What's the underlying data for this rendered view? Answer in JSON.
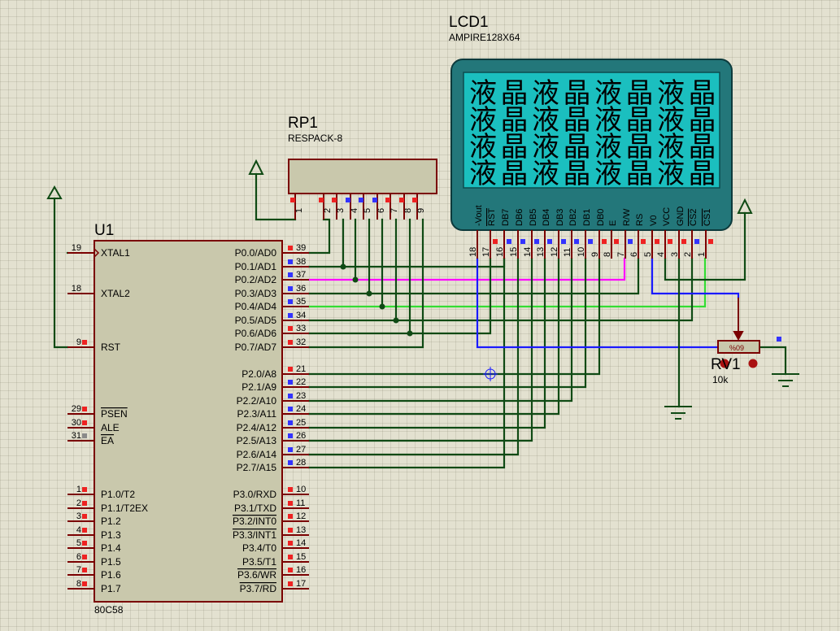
{
  "u1": {
    "ref": "U1",
    "part": "80C58",
    "left_pins": [
      {
        "num": "19",
        "label": "XTAL1"
      },
      {
        "num": "18",
        "label": "XTAL2"
      },
      {
        "num": "9",
        "label": "RST"
      },
      {
        "num": "29",
        "label": "PSEN"
      },
      {
        "num": "30",
        "label": "ALE"
      },
      {
        "num": "31",
        "label": "EA"
      },
      {
        "num": "1",
        "label": "P1.0/T2"
      },
      {
        "num": "2",
        "label": "P1.1/T2EX"
      },
      {
        "num": "3",
        "label": "P1.2"
      },
      {
        "num": "4",
        "label": "P1.3"
      },
      {
        "num": "5",
        "label": "P1.4"
      },
      {
        "num": "6",
        "label": "P1.5"
      },
      {
        "num": "7",
        "label": "P1.6"
      },
      {
        "num": "8",
        "label": "P1.7"
      }
    ],
    "right_pins": [
      {
        "num": "39",
        "label": "P0.0/AD0"
      },
      {
        "num": "38",
        "label": "P0.1/AD1"
      },
      {
        "num": "37",
        "label": "P0.2/AD2"
      },
      {
        "num": "36",
        "label": "P0.3/AD3"
      },
      {
        "num": "35",
        "label": "P0.4/AD4"
      },
      {
        "num": "34",
        "label": "P0.5/AD5"
      },
      {
        "num": "33",
        "label": "P0.6/AD6"
      },
      {
        "num": "32",
        "label": "P0.7/AD7"
      },
      {
        "num": "21",
        "label": "P2.0/A8"
      },
      {
        "num": "22",
        "label": "P2.1/A9"
      },
      {
        "num": "23",
        "label": "P2.2/A10"
      },
      {
        "num": "24",
        "label": "P2.3/A11"
      },
      {
        "num": "25",
        "label": "P2.4/A12"
      },
      {
        "num": "26",
        "label": "P2.5/A13"
      },
      {
        "num": "27",
        "label": "P2.6/A14"
      },
      {
        "num": "28",
        "label": "P2.7/A15"
      },
      {
        "num": "10",
        "label": "P3.0/RXD"
      },
      {
        "num": "11",
        "label": "P3.1/TXD"
      },
      {
        "num": "12",
        "label": "P3.2/INT0"
      },
      {
        "num": "13",
        "label": "P3.3/INT1"
      },
      {
        "num": "14",
        "label": "P3.4/T0"
      },
      {
        "num": "15",
        "label": "P3.5/T1"
      },
      {
        "num": "16",
        "label": "P3.6/WR"
      },
      {
        "num": "17",
        "label": "P3.7/RD"
      }
    ]
  },
  "rp1": {
    "ref": "RP1",
    "part": "RESPACK-8",
    "pins": [
      "1",
      "2",
      "3",
      "4",
      "5",
      "6",
      "7",
      "8",
      "9"
    ]
  },
  "lcd1": {
    "ref": "LCD1",
    "part": "AMPIRE128X64",
    "display_chars": [
      "液",
      "晶"
    ],
    "pins": [
      {
        "num": "18",
        "label": "-Vout"
      },
      {
        "num": "17",
        "label": "RST"
      },
      {
        "num": "16",
        "label": "DB7"
      },
      {
        "num": "15",
        "label": "DB6"
      },
      {
        "num": "14",
        "label": "DB5"
      },
      {
        "num": "13",
        "label": "DB4"
      },
      {
        "num": "12",
        "label": "DB3"
      },
      {
        "num": "11",
        "label": "DB2"
      },
      {
        "num": "10",
        "label": "DB1"
      },
      {
        "num": "9",
        "label": "DB0"
      },
      {
        "num": "8",
        "label": "E"
      },
      {
        "num": "7",
        "label": "R/W"
      },
      {
        "num": "6",
        "label": "RS"
      },
      {
        "num": "5",
        "label": "V0"
      },
      {
        "num": "4",
        "label": "VCC"
      },
      {
        "num": "3",
        "label": "GND"
      },
      {
        "num": "2",
        "label": "CS2"
      },
      {
        "num": "1",
        "label": "CS1"
      }
    ]
  },
  "rv1": {
    "ref": "RV1",
    "part": "10k",
    "setting": "%09"
  },
  "colors": {
    "wire": "#0f4a14",
    "wire_magenta": "#ff00ff",
    "wire_green": "#33dd33",
    "wire_blue": "#1a1aff",
    "pin_line": "#7a0000",
    "ic_fill": "#c9c8ac",
    "lcd_frame": "#23777a",
    "lcd_screen": "#1bbfbf",
    "pin_red": "#ee2222",
    "pin_blue": "#3333ff"
  }
}
